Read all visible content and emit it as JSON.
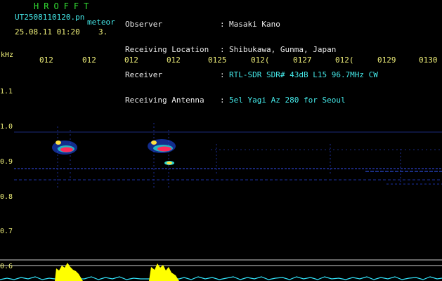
{
  "header": {
    "app_title": "HROFFT",
    "file_name": "UT2508110120.pn",
    "meteor_label": "meteor",
    "date_time": "25.08.11 01:20",
    "count": "3.",
    "info": [
      {
        "label": "Observer",
        "value": "Masaki Kano"
      },
      {
        "label": "Receiving Location",
        "value": "Shibukawa, Gunma, Japan"
      },
      {
        "label": "Receiver",
        "value": "RTL-SDR SDR# 43dB L15 96.7MHz CW"
      },
      {
        "label": "Receiving Antenna",
        "value": "5el Yagi Az 280 for Seoul"
      }
    ]
  },
  "spectrogram": {
    "y_unit": "kHz",
    "y_ticks": [
      "1.1",
      "1.0",
      "0.9",
      "0.8",
      "0.7",
      "0.6"
    ],
    "x_ticks": [
      "012",
      "012",
      "012",
      "012",
      "0125",
      "012(",
      "0127",
      "012(",
      "0129",
      "0130"
    ],
    "colors": {
      "background": "#000000",
      "text": "#f0f07a",
      "echo_core": "#ff2a5a",
      "echo_halo": "#2050ff",
      "trace_bottom": "#33e8ff",
      "trace_peak": "#ffff00"
    }
  }
}
